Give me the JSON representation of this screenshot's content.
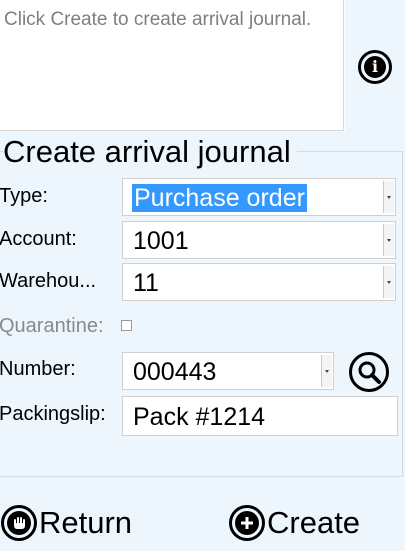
{
  "message": {
    "text": "Click Create to create arrival journal."
  },
  "form": {
    "title": "Create arrival journal",
    "type": {
      "label": "Type:",
      "value": "Purchase order"
    },
    "account": {
      "label": "Account:",
      "value": "1001"
    },
    "warehouse": {
      "label": "Warehou...",
      "value": "11"
    },
    "quarantine": {
      "label": "Quarantine:",
      "checked": false
    },
    "number": {
      "label": "Number:",
      "value": "000443"
    },
    "packingslip": {
      "label": "Packingslip:",
      "value": "Pack #1214"
    }
  },
  "footer": {
    "return_label": "Return",
    "create_label": "Create"
  },
  "icons": {
    "info": "info-icon",
    "search": "search-icon",
    "return": "stop-hand-icon",
    "create": "plus-circle-icon"
  },
  "colors": {
    "panel_background": "#eef6fd",
    "selection_highlight": "#3399ff",
    "message_text": "#7f7f7f",
    "disabled_label": "#8a8a8a"
  }
}
